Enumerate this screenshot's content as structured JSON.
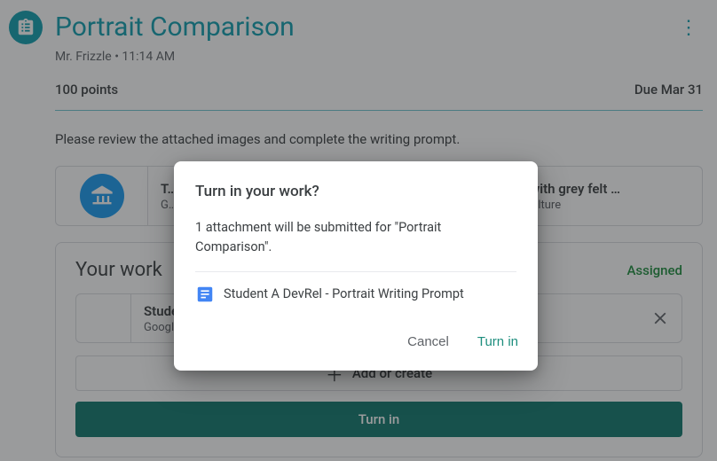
{
  "header": {
    "title": "Portrait Comparison",
    "teacher": "Mr. Frizzle",
    "time": "11:14 AM",
    "points": "100 points",
    "due": "Due Mar 31"
  },
  "description": "Please review the attached images and complete the writing prompt.",
  "attachments": [
    {
      "title": "T…",
      "source": "G…"
    },
    {
      "title": "ortrait with grey felt …",
      "source": "Arts & Culture"
    }
  ],
  "work": {
    "heading": "Your work",
    "status": "Assigned",
    "file": {
      "title": "Studen…",
      "subtitle": "Google …"
    },
    "add_label": "Add or create",
    "turnin_label": "Turn in"
  },
  "dialog": {
    "title": "Turn in your work?",
    "message": "1 attachment will be submitted for \"Portrait Comparison\".",
    "file": "Student A DevRel - Portrait Writing Prompt",
    "cancel": "Cancel",
    "confirm": "Turn in"
  }
}
